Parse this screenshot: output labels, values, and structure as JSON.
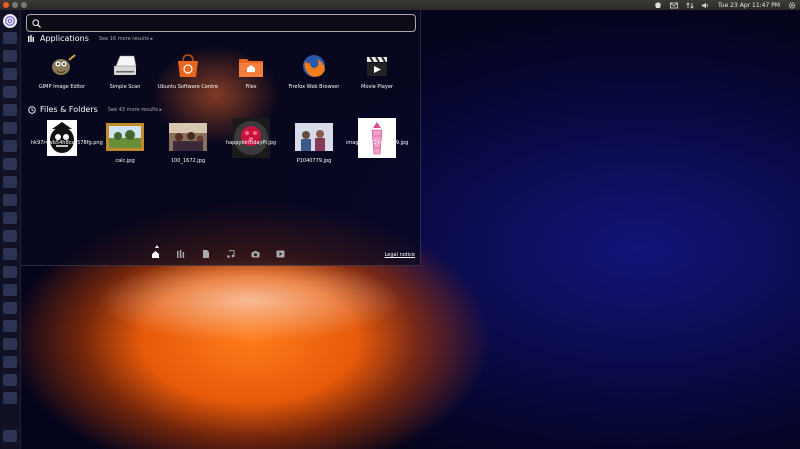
{
  "top_panel": {
    "clock": "Tue 23 Apr  11:47 PM"
  },
  "search": {
    "value": "",
    "placeholder": ""
  },
  "applications": {
    "title": "Applications",
    "more": "See 16 more results",
    "items": [
      {
        "label": "GIMP Image Editor",
        "icon": "gimp-icon"
      },
      {
        "label": "Simple Scan",
        "icon": "scanner-icon"
      },
      {
        "label": "Ubuntu Software Centre",
        "icon": "software-centre-icon"
      },
      {
        "label": "Files",
        "icon": "home-folder-icon"
      },
      {
        "label": "Firefox Web Browser",
        "icon": "firefox-icon"
      },
      {
        "label": "Movie Player",
        "icon": "movie-player-icon"
      }
    ]
  },
  "files": {
    "title": "Files & Folders",
    "more": "See 43 more results",
    "items": [
      {
        "label": "hk97r4wb54h8csp578fg.png"
      },
      {
        "label": "calc.jpg"
      },
      {
        "label": "100_1672.jpg"
      },
      {
        "label": "happybirthdayPi.jpg"
      },
      {
        "label": "P1040779.jpg"
      },
      {
        "label": "image_12724461979.jpg"
      }
    ]
  },
  "lens_bar": {
    "items": [
      "home-lens-icon",
      "applications-lens-icon",
      "files-lens-icon",
      "music-lens-icon",
      "photos-lens-icon",
      "video-lens-icon"
    ],
    "active": "home-lens-icon"
  },
  "legal_notice": "Legal notice",
  "colors": {
    "accent": "#f15d22",
    "dash_bg": "#08081e",
    "wallpaper_orange": "#ff7a1a",
    "wallpaper_blue": "#14147a"
  }
}
